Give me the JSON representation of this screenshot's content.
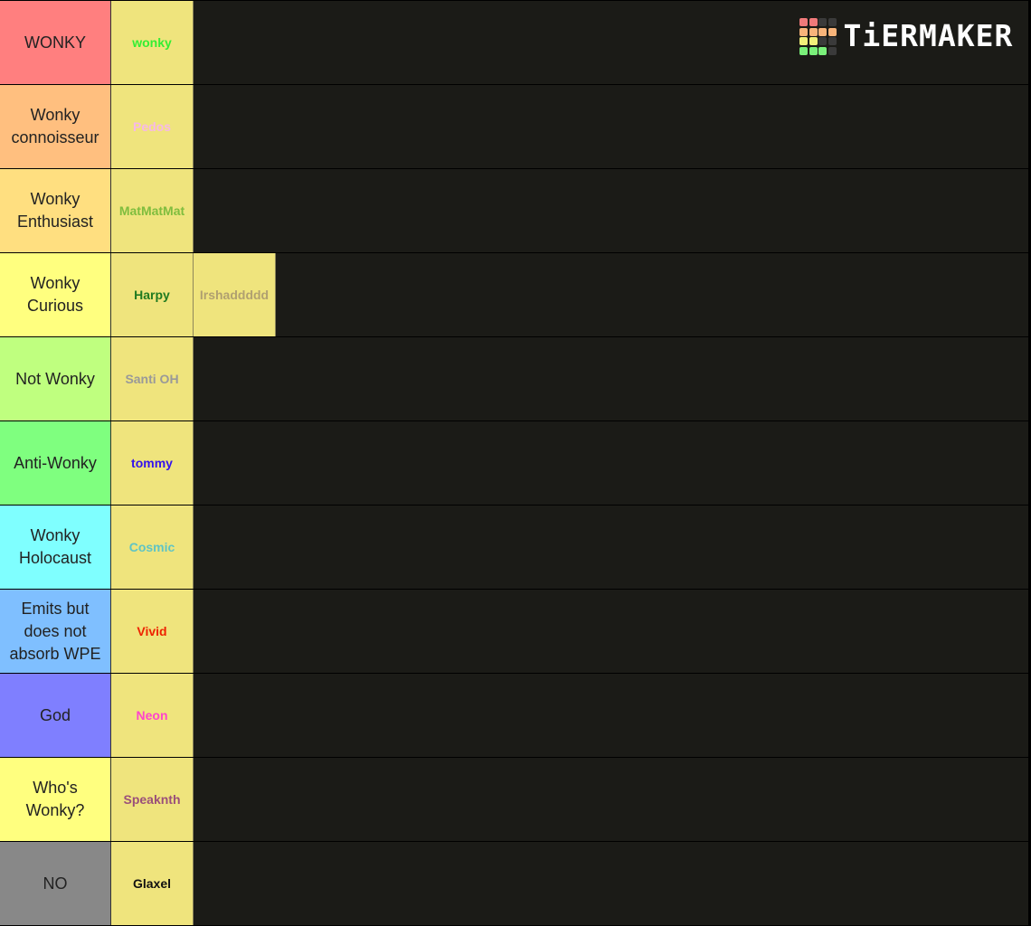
{
  "logo": {
    "text": "TiERMAKER",
    "grid_colors": [
      "#f07a7a",
      "#f07a7a",
      "#3a3a3a",
      "#3a3a3a",
      "#f8b47a",
      "#f8b47a",
      "#f8b47a",
      "#f8b47a",
      "#f2f07a",
      "#f2f07a",
      "#3a3a3a",
      "#3a3a3a",
      "#7af07a",
      "#7af07a",
      "#7af07a",
      "#3a3a3a"
    ]
  },
  "tiers": [
    {
      "label": "WONKY",
      "color": "#ff7f7f",
      "items": [
        {
          "name": "wonky",
          "color": "#33ee33"
        }
      ]
    },
    {
      "label": "Wonky connoisseur",
      "color": "#ffbf7f",
      "items": [
        {
          "name": "Pedos",
          "color": "#f7b8e8"
        }
      ]
    },
    {
      "label": "Wonky Enthusiast",
      "color": "#ffdf80",
      "items": [
        {
          "name": "MatMatMat",
          "color": "#7fbd3e"
        }
      ]
    },
    {
      "label": "Wonky Curious",
      "color": "#ffff7f",
      "items": [
        {
          "name": "Harpy",
          "color": "#207a20"
        },
        {
          "name": "Irshaddddd",
          "color": "#b0a070"
        }
      ]
    },
    {
      "label": "Not Wonky",
      "color": "#bfff7f",
      "items": [
        {
          "name": "Santi OH",
          "color": "#999999"
        }
      ]
    },
    {
      "label": "Anti-Wonky",
      "color": "#7fff7f",
      "items": [
        {
          "name": "tommy",
          "color": "#3311ee"
        }
      ]
    },
    {
      "label": "Wonky Holocaust",
      "color": "#7fffff",
      "items": [
        {
          "name": "Cosmic",
          "color": "#5fc4c4"
        }
      ]
    },
    {
      "label": "Emits but does not absorb WPE",
      "color": "#7fbfff",
      "items": [
        {
          "name": "Vivid",
          "color": "#ee2200"
        }
      ]
    },
    {
      "label": "God",
      "color": "#7f7fff",
      "items": [
        {
          "name": "Neon",
          "color": "#ff44cc"
        }
      ]
    },
    {
      "label": "Who's Wonky?",
      "color": "#ffff7f",
      "items": [
        {
          "name": "Speaknth",
          "color": "#9a4f7a"
        }
      ]
    },
    {
      "label": "NO",
      "color": "#888888",
      "items": [
        {
          "name": "Glaxel",
          "color": "#111111"
        }
      ]
    }
  ]
}
